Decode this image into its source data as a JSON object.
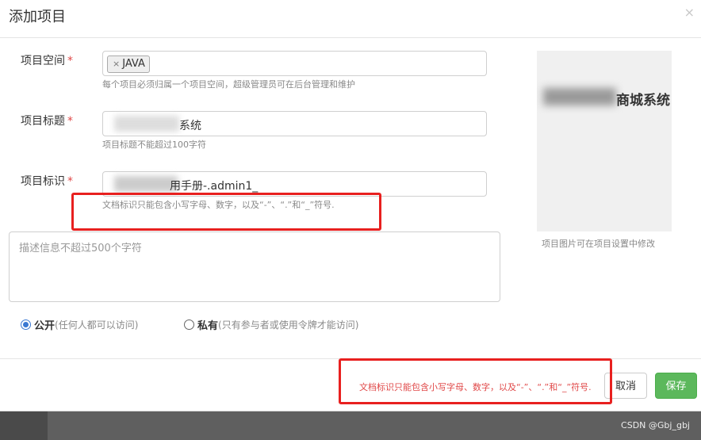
{
  "dialog": {
    "title": "添加项目",
    "close_symbol": "×"
  },
  "form": {
    "space": {
      "label": "项目空间",
      "required_mark": "*",
      "tag_remove_symbol": "×",
      "tag_value": "JAVA",
      "help": "每个项目必须归属一个项目空间，超级管理员可在后台管理和维护"
    },
    "title": {
      "label": "项目标题",
      "required_mark": "*",
      "value_visible": "系统",
      "help": "项目标题不能超过100字符"
    },
    "identifier": {
      "label": "项目标识",
      "required_mark": "*",
      "value_visible": "用手册-.admin1_",
      "help": "文档标识只能包含小写字母、数字，以及“-”、“.”和“_”符号."
    },
    "description": {
      "placeholder": "描述信息不超过500个字符"
    },
    "visibility": {
      "public_label": "公开",
      "public_desc": "(任何人都可以访问)",
      "private_label": "私有",
      "private_desc": "(只有参与者或使用令牌才能访问)",
      "selected": "public"
    }
  },
  "image_panel": {
    "visible_text": "商城系统",
    "hint": "项目图片可在项目设置中修改"
  },
  "footer": {
    "error_message": "文档标识只能包含小写字母、数字，以及“-”、“.”和“_”符号.",
    "cancel_label": "取消",
    "save_label": "保存"
  },
  "watermark": "CSDN @Gbj_gbj",
  "colors": {
    "required": "#e04848",
    "save_button": "#5cb85c",
    "radio_accent": "#3a78d2",
    "annotation_frame": "#e8201f"
  }
}
